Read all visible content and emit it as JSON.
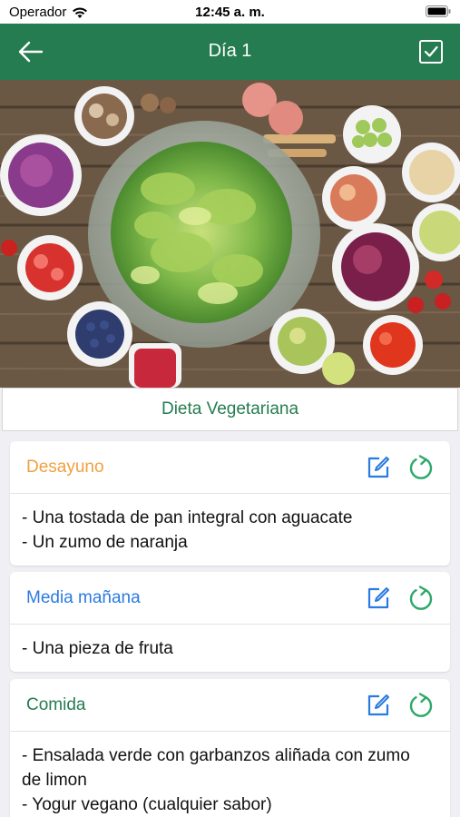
{
  "status": {
    "carrier": "Operador",
    "time": "12:45 a. m."
  },
  "nav": {
    "title": "Día 1",
    "back_icon": "arrow-left-icon",
    "done_icon": "checkbox-checked-icon"
  },
  "diet": {
    "name": "Dieta Vegetariana"
  },
  "meals": [
    {
      "title": "Desayuno",
      "color": "#f0a040",
      "items": [
        "- Una tostada de pan integral con aguacate",
        "- Un zumo de naranja"
      ]
    },
    {
      "title": "Media mañana",
      "color": "#2a7ae2",
      "items": [
        "- Una pieza de fruta"
      ]
    },
    {
      "title": "Comida",
      "color": "#257c50",
      "items": [
        "- Ensalada verde con garbanzos aliñada con zumo de limon",
        "- Yogur vegano (cualquier sabor)"
      ]
    }
  ],
  "colors": {
    "primary": "#257c50",
    "edit_icon": "#2a7ae2",
    "refresh_icon": "#2ea86a"
  }
}
